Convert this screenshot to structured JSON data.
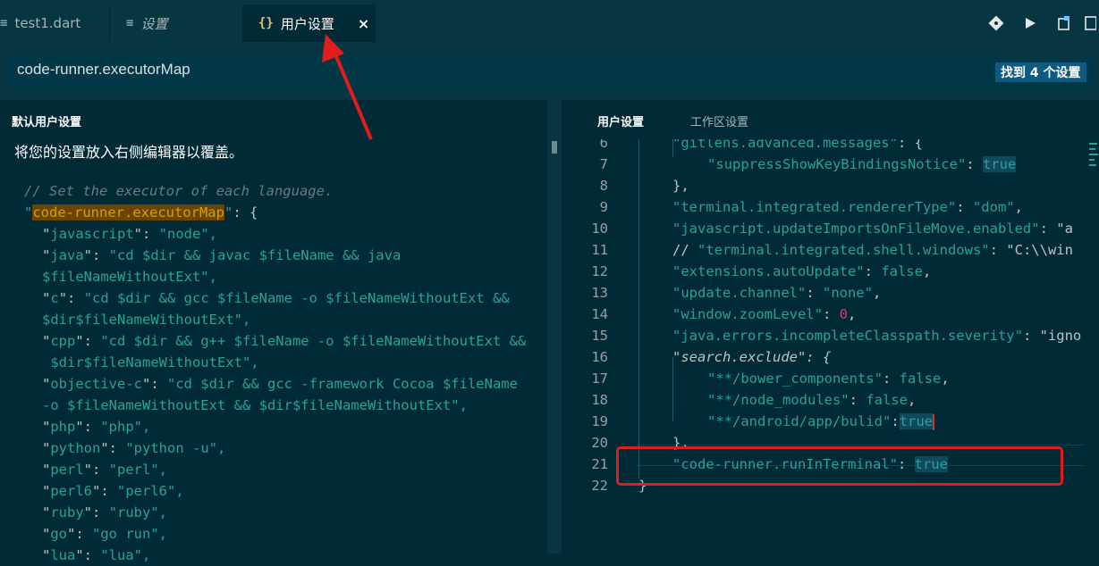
{
  "tabs": [
    {
      "icon": "≡",
      "label": "test1.dart",
      "active": false
    },
    {
      "icon": "≡",
      "label": "设置",
      "active": false
    },
    {
      "icon": "{}",
      "label": "用户设置",
      "active": true,
      "close": "×"
    }
  ],
  "search": {
    "value": "code-runner.executorMap",
    "result_badge": "找到 4 个设置"
  },
  "left": {
    "header": "默认用户设置",
    "hint": "将您的设置放入右侧编辑器以覆盖。",
    "comment": "// Set the executor of each language.",
    "map_key": "code-runner.executorMap",
    "entries": [
      {
        "key": "javascript",
        "value": "\"node\","
      },
      {
        "key": "java",
        "value": "\"cd $dir && javac $fileName && java",
        "cont": "$fileNameWithoutExt\","
      },
      {
        "key": "c",
        "value": "\"cd $dir && gcc $fileName -o $fileNameWithoutExt &&",
        "cont": "$dir$fileNameWithoutExt\","
      },
      {
        "key": "cpp",
        "value": "\"cd $dir && g++ $fileName -o $fileNameWithoutExt &&",
        "cont": " $dir$fileNameWithoutExt\","
      },
      {
        "key": "objective-c",
        "value": "\"cd $dir && gcc -framework Cocoa $fileName",
        "cont": "-o $fileNameWithoutExt && $dir$fileNameWithoutExt\","
      },
      {
        "key": "php",
        "value": "\"php\","
      },
      {
        "key": "python",
        "value": "\"python -u\","
      },
      {
        "key": "perl",
        "value": "\"perl\","
      },
      {
        "key": "perl6",
        "value": "\"perl6\","
      },
      {
        "key": "ruby",
        "value": "\"ruby\","
      },
      {
        "key": "go",
        "value": "\"go run\","
      },
      {
        "key": "lua",
        "value": "\"lua\","
      }
    ]
  },
  "right": {
    "tabs": [
      "用户设置",
      "工作区设置"
    ],
    "lines": [
      {
        "n": "6",
        "text": "\"gitlens.advanced.messages\": {"
      },
      {
        "n": "7",
        "text": "\"suppressShowKeyBindingsNotice\": true"
      },
      {
        "n": "8",
        "text": "},"
      },
      {
        "n": "9",
        "text": "\"terminal.integrated.rendererType\": \"dom\","
      },
      {
        "n": "10",
        "text": "\"javascript.updateImportsOnFileMove.enabled\": \"a"
      },
      {
        "n": "11",
        "text": "// \"terminal.integrated.shell.windows\": \"C:\\\\win"
      },
      {
        "n": "12",
        "text": "\"extensions.autoUpdate\": false,"
      },
      {
        "n": "13",
        "text": "\"update.channel\": \"none\","
      },
      {
        "n": "14",
        "text": "\"window.zoomLevel\": 0,"
      },
      {
        "n": "15",
        "text": "\"java.errors.incompleteClasspath.severity\": \"igno"
      },
      {
        "n": "16",
        "text": "\"search.exclude\": {"
      },
      {
        "n": "17",
        "text": "\"**/bower_components\": false,"
      },
      {
        "n": "18",
        "text": "\"**/node_modules\": false,"
      },
      {
        "n": "19",
        "text": "\"**/android/app/bulid\":true"
      },
      {
        "n": "20",
        "text": "},"
      },
      {
        "n": "21",
        "text": "\"code-runner.runInTerminal\": true"
      },
      {
        "n": "22",
        "text": "}"
      }
    ]
  },
  "colors": {
    "accent": "#0e5a80",
    "annotation": "#e21c1c",
    "background": "#002b36"
  }
}
